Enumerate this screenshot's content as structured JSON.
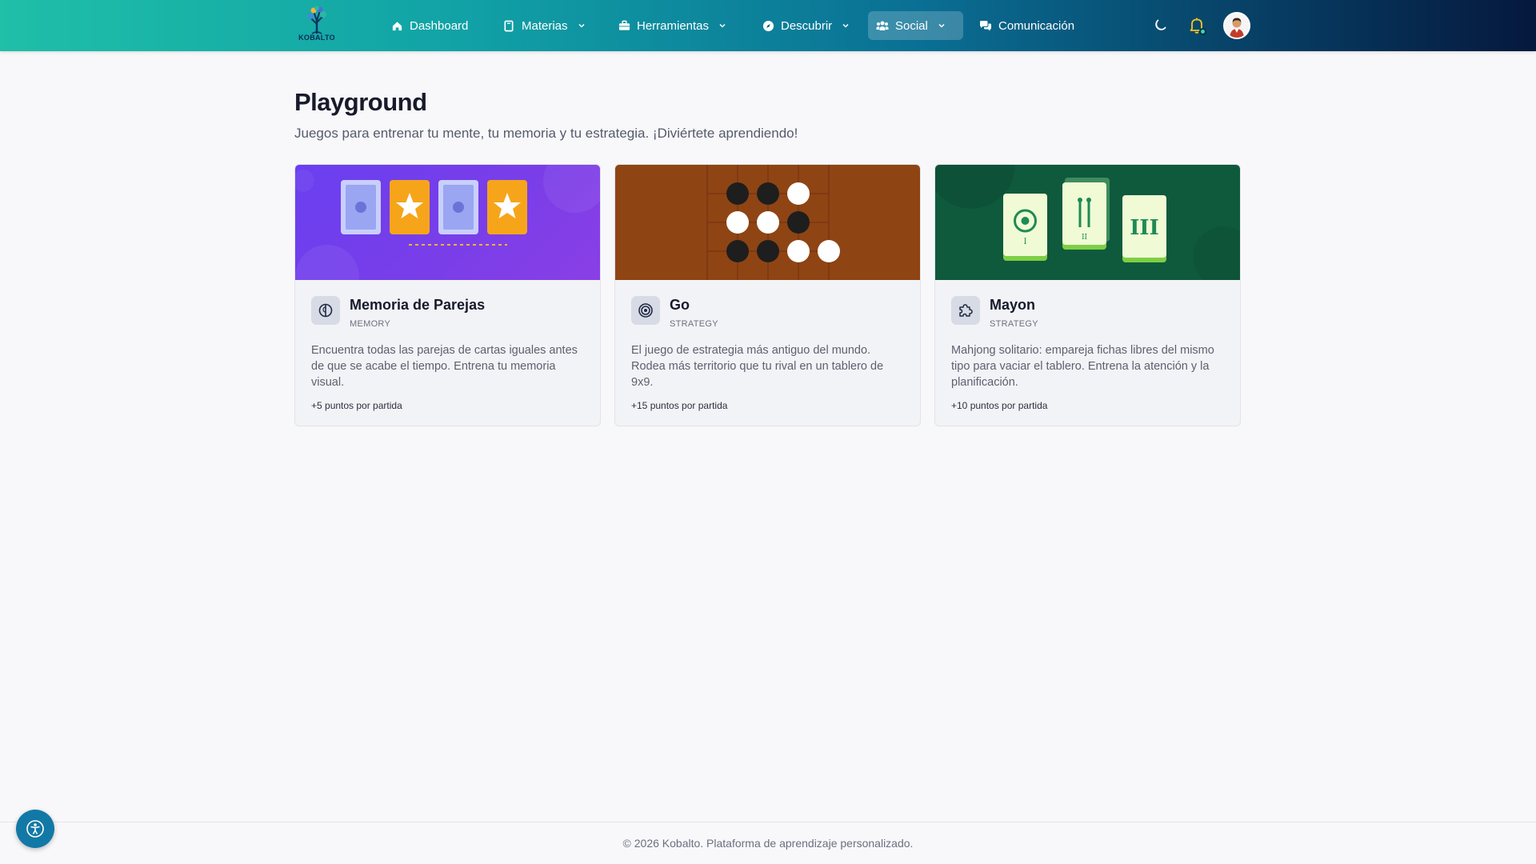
{
  "brand": {
    "logo_text": "KOBALTO"
  },
  "nav": {
    "items": [
      {
        "label": "Dashboard",
        "icon": "home-icon"
      },
      {
        "label": "Materias",
        "icon": "book-icon"
      },
      {
        "label": "Herramientas",
        "icon": "briefcase-icon"
      },
      {
        "label": "Descubrir",
        "icon": "compass-icon"
      },
      {
        "label": "Social",
        "icon": "users-icon",
        "active": true
      },
      {
        "label": "Comunicación",
        "icon": "chat-icon"
      }
    ]
  },
  "header_actions": {
    "theme_icon": "moon-icon",
    "notifications_icon": "bell-icon",
    "avatar_icon": "avatar"
  },
  "page": {
    "title": "Playground",
    "subtitle": "Juegos para entrenar tu mente, tu memoria y tu estrategia. ¡Diviértete aprendiendo!"
  },
  "games": [
    {
      "title": "Memoria de Parejas",
      "category": "MEMORY",
      "description": "Encuentra todas las parejas de cartas iguales antes de que se acabe el tiempo. Entrena tu memoria visual.",
      "points": "+5 puntos por partida",
      "icon": "brain-icon",
      "banner_color": "#7a3fee"
    },
    {
      "title": "Go",
      "category": "STRATEGY",
      "description": "El juego de estrategia más antiguo del mundo. Rodea más territorio que tu rival en un tablero de 9x9.",
      "points": "+15 puntos por partida",
      "icon": "target-icon",
      "banner_color": "#8f4413"
    },
    {
      "title": "Mayon",
      "category": "STRATEGY",
      "description": "Mahjong solitario: empareja fichas libres del mismo tipo para vaciar el tablero. Entrena la atención y la planificación.",
      "points": "+10 puntos por partida",
      "icon": "puzzle-icon",
      "banner_color": "#0f5a3d"
    }
  ],
  "mahjong_tiles": [
    "I",
    "II",
    "III"
  ],
  "footer": {
    "text": "© 2026 Kobalto. Plataforma de aprendizaje personalizado."
  },
  "accessibility": {
    "icon": "accessibility-icon"
  }
}
